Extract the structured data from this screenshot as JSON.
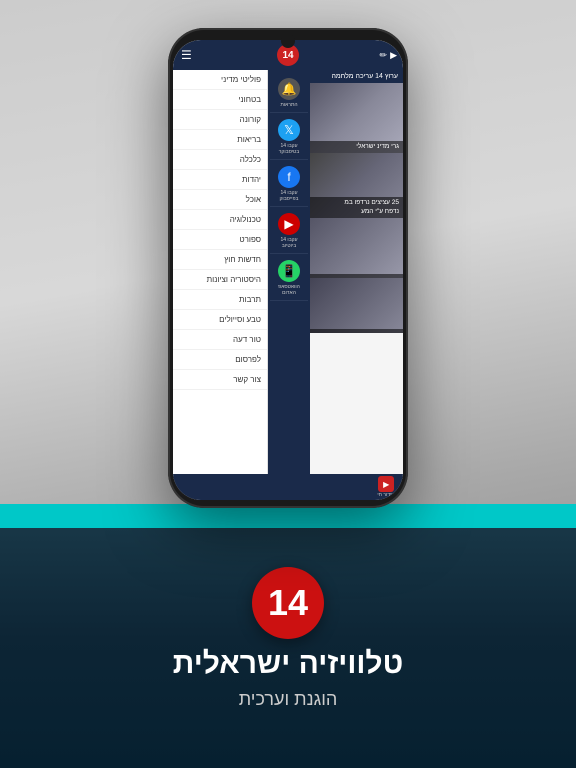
{
  "background": {
    "gradient_start": "#cccccc",
    "gradient_end": "#888888"
  },
  "phone": {
    "header": {
      "logo_number": "14",
      "menu_icon": "☰"
    },
    "side_panel": {
      "items": [
        {
          "icon": "🔔",
          "label": "התראות",
          "type": "bell"
        },
        {
          "icon": "🐦",
          "label": "עקבו 14\nבטיסבוקר",
          "type": "twitter"
        },
        {
          "icon": "f",
          "label": "עקבו 14\nבפייסבוק",
          "type": "facebook"
        },
        {
          "icon": "▶",
          "label": "עקבו 14\nביוטיוב",
          "type": "youtube"
        },
        {
          "icon": "📱",
          "label": "הוואטסאפ\nהאדום",
          "type": "whatsapp"
        }
      ]
    },
    "menu": {
      "items": [
        "פוליטי מדיני",
        "בטחוני",
        "קורונה",
        "בריאות",
        "כלכלה",
        "יהדות",
        "אוכל",
        "טכנולוגיה",
        "ספורט",
        "חדשות חוץ",
        "היסטוריה וציונות",
        "תרבות",
        "טבע וסייולים",
        "טור דעה",
        "לפרסום",
        "צור קשר"
      ]
    },
    "news": {
      "top_text": "ערוץ 14 עריכה",
      "items": [
        {
          "caption": "25 עציצים נרדפו במ נדפח ע\"י המע"
        },
        {
          "caption": ""
        }
      ]
    },
    "bottom_nav": {
      "live_label": "שידור חי",
      "live_icon": "▶"
    }
  },
  "branding": {
    "logo_number": "14",
    "title": "טלוויזיה ישראלית",
    "subtitle": "הוגנת וערכית"
  }
}
